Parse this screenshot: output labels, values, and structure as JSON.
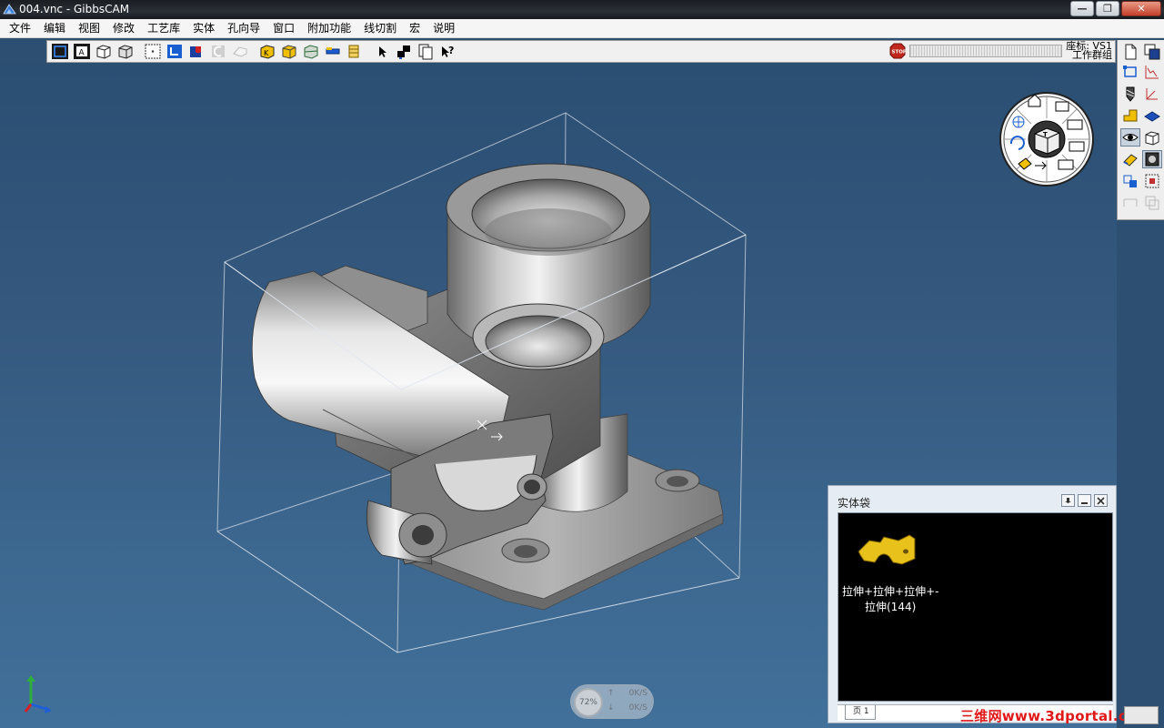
{
  "window": {
    "title": "004.vnc - GibbsCAM",
    "min_label": "—",
    "max_label": "❐",
    "close_label": "✕"
  },
  "menu": [
    "文件",
    "编辑",
    "视图",
    "修改",
    "工艺库",
    "实体",
    "孔向导",
    "窗口",
    "附加功能",
    "线切割",
    "宏",
    "说明"
  ],
  "toolbar": {
    "coord_line1": "座标: VS1",
    "coord_line2": "工作群组"
  },
  "solids_panel": {
    "title": "实体袋",
    "solid_name_line1": "拉伸+拉伸+拉伸+-",
    "solid_name_line2": "拉伸(144)",
    "tab_label": "页 1"
  },
  "speed_widget": {
    "percent": "72%",
    "up_rate": "0K/S",
    "down_rate": "0K/S",
    "up_arrow": "↑",
    "down_arrow": "↓"
  },
  "watermark": "三维网www.3dportal.cn",
  "colors": {
    "title_bg": "#1f242a",
    "canvas_top": "#2b4e73",
    "canvas_bottom": "#41709a",
    "solid_thumb": "#e8c21a",
    "watermark": "#e01818"
  }
}
